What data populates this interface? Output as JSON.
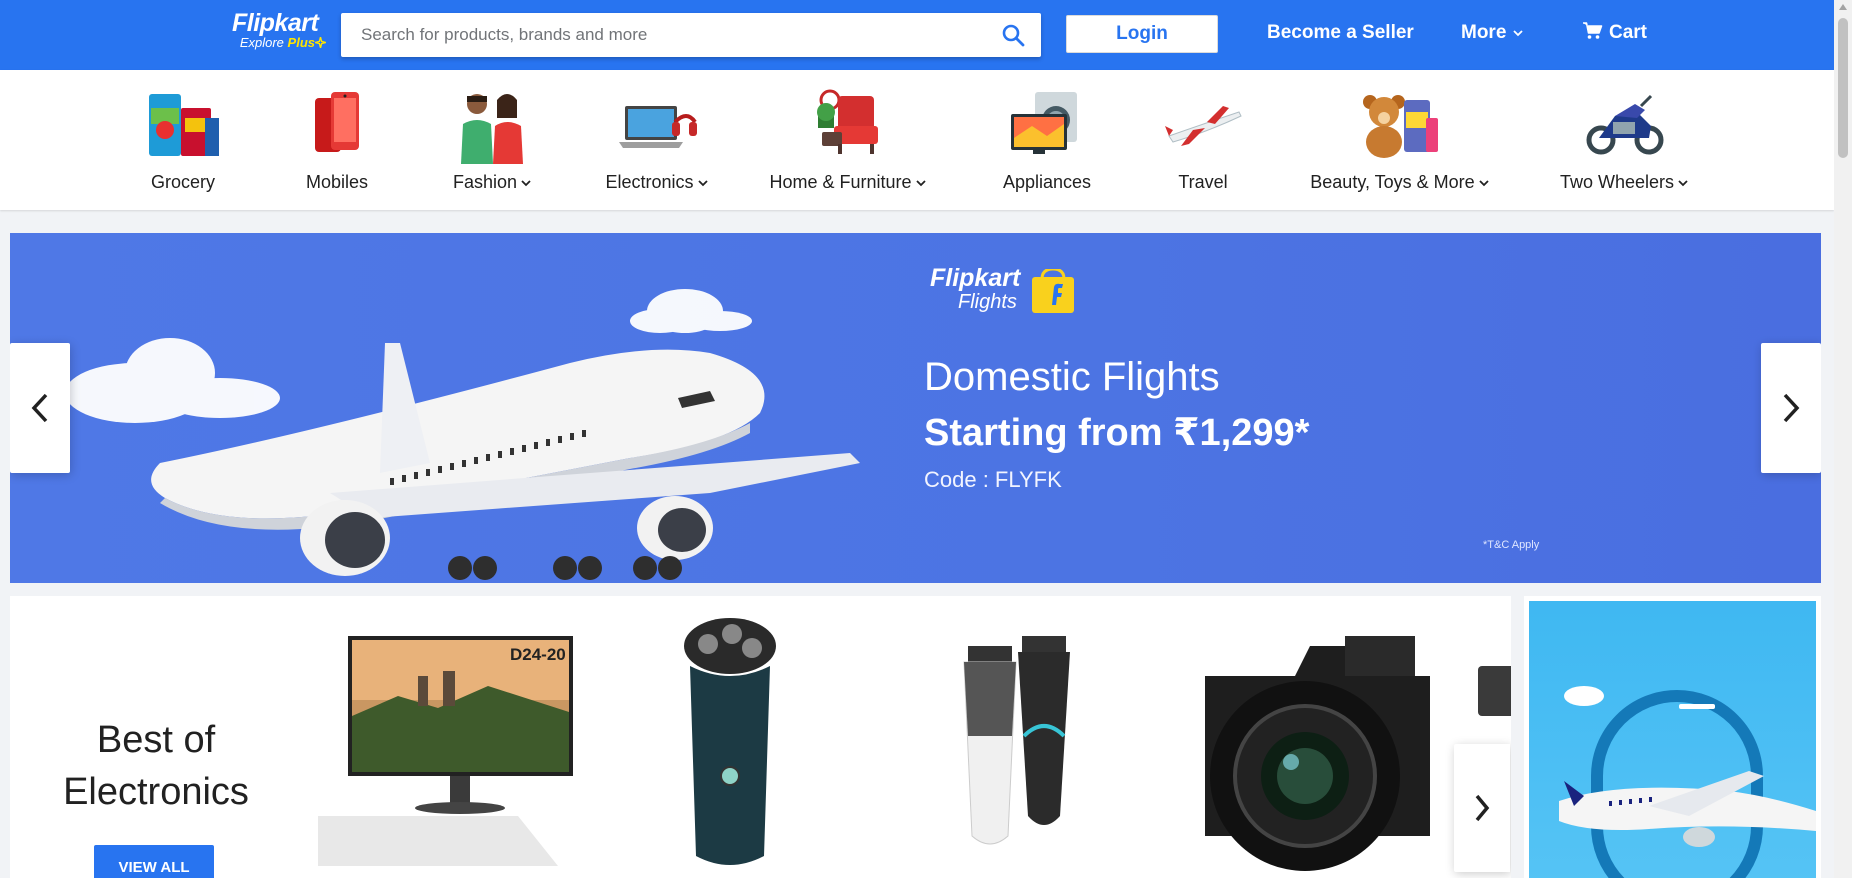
{
  "header": {
    "logo_brand": "Flipkart",
    "logo_tag": "Explore",
    "logo_plus": "Plus",
    "search_placeholder": "Search for products, brands and more",
    "login_label": "Login",
    "seller_label": "Become a Seller",
    "more_label": "More",
    "cart_label": "Cart",
    "colors": {
      "header_bg": "#2874f0",
      "accent_yellow": "#ffe500"
    }
  },
  "categories": [
    {
      "label": "Grocery",
      "has_dropdown": false,
      "icon": "grocery-icon"
    },
    {
      "label": "Mobiles",
      "has_dropdown": false,
      "icon": "mobile-phone-icon"
    },
    {
      "label": "Fashion",
      "has_dropdown": true,
      "icon": "fashion-icon"
    },
    {
      "label": "Electronics",
      "has_dropdown": true,
      "icon": "laptop-icon"
    },
    {
      "label": "Home & Furniture",
      "has_dropdown": true,
      "icon": "armchair-icon"
    },
    {
      "label": "Appliances",
      "has_dropdown": false,
      "icon": "appliances-icon"
    },
    {
      "label": "Travel",
      "has_dropdown": false,
      "icon": "airplane-icon"
    },
    {
      "label": "Beauty, Toys & More",
      "has_dropdown": true,
      "icon": "teddy-bear-icon"
    },
    {
      "label": "Two Wheelers",
      "has_dropdown": true,
      "icon": "motorcycle-icon"
    }
  ],
  "banner": {
    "brand": "Flipkart",
    "brand_sub": "Flights",
    "title": "Domestic Flights",
    "subtitle": "Starting from ₹1,299*",
    "code": "Code : FLYFK",
    "tc": "*T&C Apply"
  },
  "best_of": {
    "title_line1": "Best of",
    "title_line2": "Electronics",
    "view_all_label": "VIEW ALL",
    "monitor_label": "D24-20",
    "products": [
      {
        "icon": "monitor-icon"
      },
      {
        "icon": "shaver-icon"
      },
      {
        "icon": "trimmer-icon"
      },
      {
        "icon": "camera-icon"
      }
    ]
  }
}
